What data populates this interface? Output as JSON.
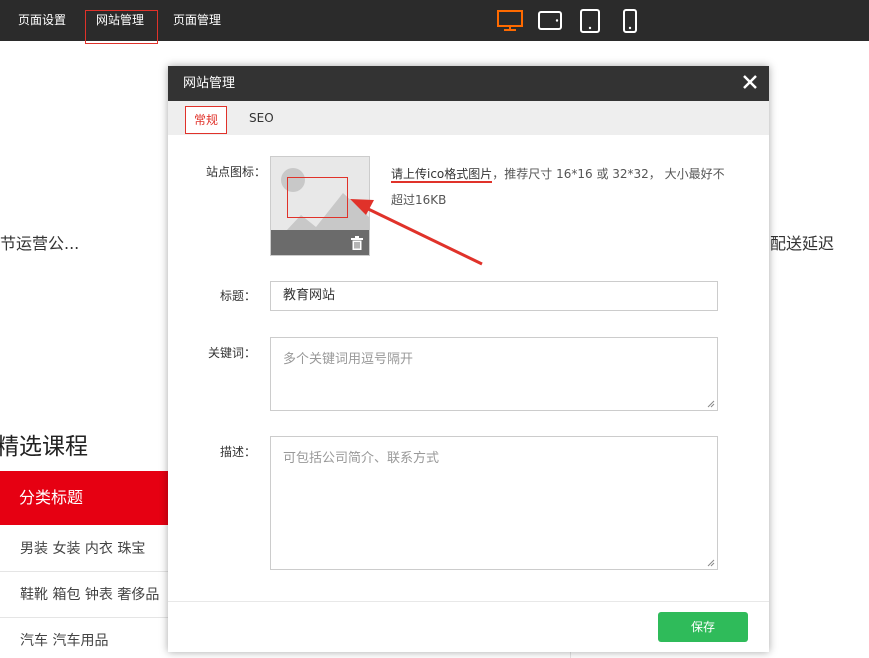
{
  "topbar": {
    "nav": [
      "页面设置",
      "网站管理",
      "页面管理"
    ],
    "devices": [
      "desktop-icon",
      "tablet-landscape-icon",
      "tablet-portrait-icon",
      "mobile-icon"
    ],
    "active_device_color": "#ff6a00"
  },
  "background": {
    "left_text": "节运营公...",
    "right_text": "配送延迟",
    "heading": "精选课程",
    "category_header": "分类标题",
    "category_items": [
      "男装 女装 内衣 珠宝",
      "鞋靴 箱包 钟表 奢侈品",
      "汽车 汽车用品"
    ],
    "accent_color": "#e60012"
  },
  "modal": {
    "title": "网站管理",
    "tabs": [
      "常规",
      "SEO"
    ],
    "fields": {
      "icon_label": "站点图标：",
      "icon_hint_link": "请上传ico格式图片",
      "icon_hint_rest": "，推荐尺寸 16*16 或 32*32， 大小最好不超过16KB",
      "title_label": "标题：",
      "title_value": "教育网站",
      "keywords_label": "关键词：",
      "keywords_placeholder": "多个关键词用逗号隔开",
      "description_label": "描述：",
      "description_placeholder": "可包括公司简介、联系方式"
    },
    "save_label": "保存",
    "save_color": "#2fbb5a"
  }
}
